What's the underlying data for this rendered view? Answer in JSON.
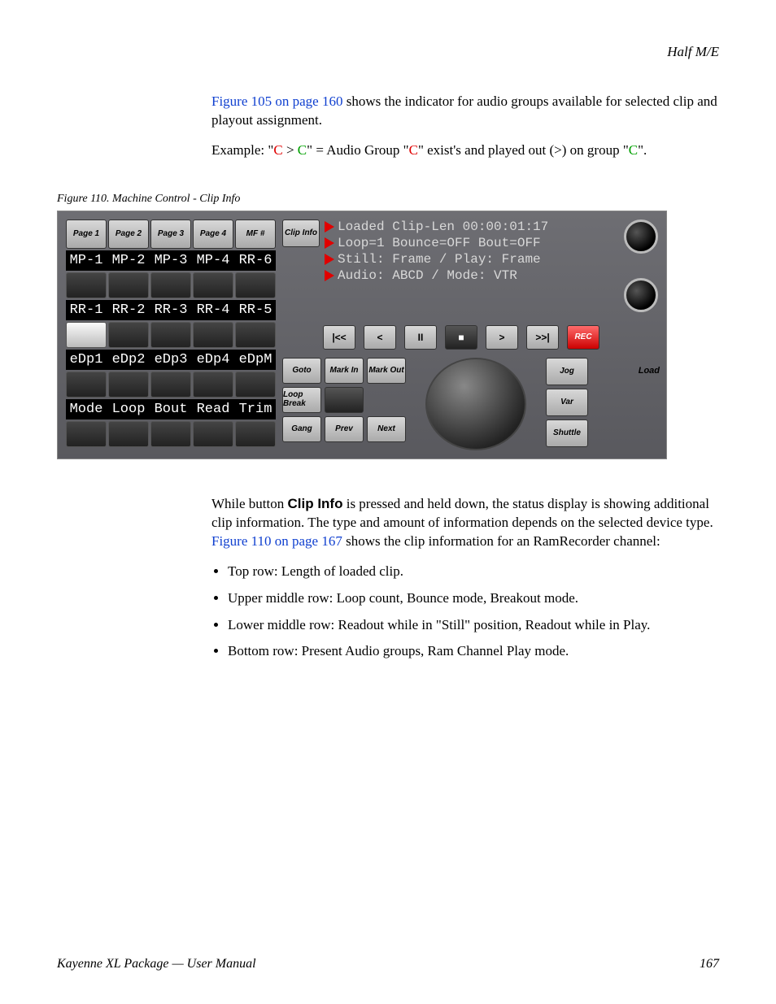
{
  "header": {
    "section": "Half M/E"
  },
  "intro": {
    "ref1": "Figure 105 on page 160",
    "after_ref1": " shows the indicator for audio groups available for selected clip and playout assignment.",
    "example_prefix": "Example: \"",
    "c1": "C",
    "gt": " > ",
    "c2": "C",
    "mid": "\" = Audio Group \"",
    "c3": "C",
    "mid2": "\" exist's and played out (>) on group \"",
    "c4": "C",
    "end": "\"."
  },
  "fig_caption": "Figure 110.  Machine Control - Clip Info",
  "panel": {
    "top_btns": [
      "Page 1",
      "Page 2",
      "Page 3",
      "Page 4",
      "MF #"
    ],
    "row1": [
      "MP-1",
      "MP-2",
      "MP-3",
      "MP-4",
      "RR-6"
    ],
    "row2": [
      "RR-1",
      "RR-2",
      "RR-3",
      "RR-4",
      "RR-5"
    ],
    "row3": [
      "eDp1",
      "eDp2",
      "eDp3",
      "eDp4",
      "eDpM"
    ],
    "row4": [
      "Mode",
      "Loop",
      "Bout",
      "Read",
      "Trim"
    ],
    "clip_info_btn": "Clip Info",
    "clip_lines": [
      "Loaded Clip-Len 00:00:01:17",
      "Loop=1 Bounce=OFF Bout=OFF",
      "Still: Frame / Play: Frame",
      "Audio: ABCD  / Mode: VTR"
    ],
    "transport": [
      "|<<",
      "<",
      "II",
      "■",
      ">",
      ">>|"
    ],
    "rec": "REC",
    "load": "Load",
    "ctrl_left": [
      "Goto",
      "Mark In",
      "Mark Out",
      "Loop Break",
      "",
      "",
      "Gang",
      "Prev",
      "Next"
    ],
    "side": [
      "Jog",
      "Var",
      "Shuttle"
    ]
  },
  "body2": {
    "p1_a": "While button ",
    "p1_bold": "Clip Info",
    "p1_b": " is pressed and held down, the status display is showing additional clip information. The type and amount of information depends on the selected device type. ",
    "p1_link": "Figure 110 on page 167",
    "p1_c": " shows the clip information for an RamRecorder channel:",
    "bullets": [
      "Top row: Length of loaded clip.",
      "Upper middle row: Loop count, Bounce mode, Breakout mode.",
      "Lower middle row: Readout while in \"Still\" position, Readout while in Play.",
      "Bottom row: Present Audio groups, Ram Channel Play mode."
    ]
  },
  "footer": {
    "left": "Kayenne XL Package — User Manual",
    "right": "167"
  }
}
